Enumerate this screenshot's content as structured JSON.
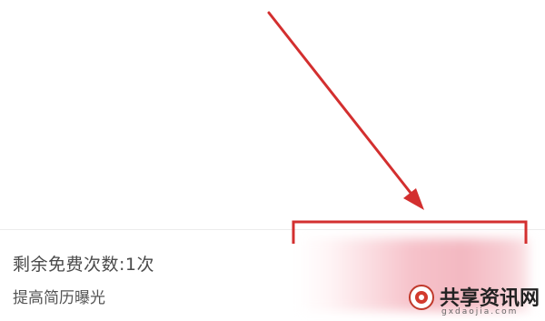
{
  "free_count": {
    "label": "剩余免费次数:1次"
  },
  "exposure": {
    "label": "提高简历曝光"
  },
  "watermark": {
    "name": "共享资讯网",
    "domain": "gxdaojia.com"
  },
  "colors": {
    "annotation": "#d32f2f",
    "blur_pink": "#f3b8c1",
    "text": "#4a4a4a"
  },
  "icons": {
    "watermark_logo": "circle-logo-icon"
  }
}
